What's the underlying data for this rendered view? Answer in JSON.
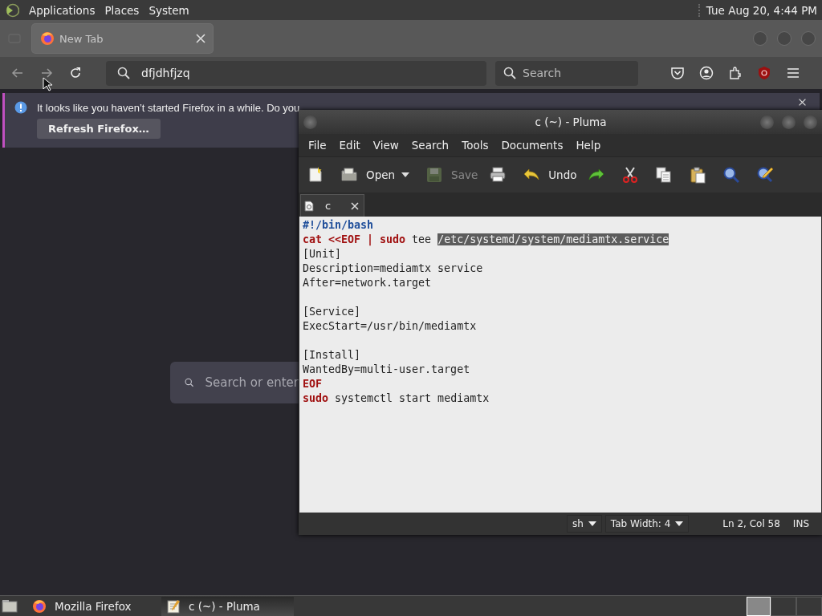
{
  "top_panel": {
    "menus": [
      "Applications",
      "Places",
      "System"
    ],
    "clock": "Tue Aug 20,  4:44 PM"
  },
  "firefox": {
    "tabs": [
      {
        "label": "New Tab",
        "selected": true
      }
    ],
    "url_value": "dfjdhfjzq",
    "search_placeholder": "Search",
    "notification": {
      "message": "It looks like you haven’t started Firefox in a while. Do you",
      "button": "Refresh Firefox…"
    },
    "newtab_search_placeholder": "Search or enter"
  },
  "pluma": {
    "title": "c (~) - Pluma",
    "menus": [
      "File",
      "Edit",
      "View",
      "Search",
      "Tools",
      "Documents",
      "Help"
    ],
    "toolbar": [
      {
        "kind": "new",
        "disabled": false
      },
      {
        "kind": "open",
        "label": "Open",
        "disabled": false
      },
      {
        "kind": "save",
        "label": "Save",
        "disabled": true
      },
      {
        "kind": "print",
        "disabled": false
      },
      {
        "kind": "undo",
        "label": "Undo",
        "disabled": false
      },
      {
        "kind": "redo",
        "disabled": false
      },
      {
        "kind": "cut",
        "disabled": false
      },
      {
        "kind": "copy",
        "disabled": false
      },
      {
        "kind": "paste",
        "disabled": false
      },
      {
        "kind": "find",
        "disabled": false
      },
      {
        "kind": "replace",
        "disabled": false
      }
    ],
    "document_tab": "c",
    "lines": [
      {
        "kind": "code",
        "segments": [
          {
            "kind": "shebang",
            "text": "#!/bin/bash",
            "selected": false
          }
        ]
      },
      {
        "kind": "code",
        "segments": [
          {
            "kind": "keyword",
            "text": "cat <<EOF | sudo",
            "selected": false
          },
          {
            "kind": "text",
            "text": " tee ",
            "selected": false
          },
          {
            "kind": "text",
            "text": "/etc/systemd/system/mediamtx.service",
            "selected": true
          }
        ]
      },
      {
        "kind": "code",
        "segments": [
          {
            "kind": "text",
            "text": "[Unit]",
            "selected": false
          }
        ]
      },
      {
        "kind": "code",
        "segments": [
          {
            "kind": "text",
            "text": "Description=mediamtx service",
            "selected": false
          }
        ]
      },
      {
        "kind": "code",
        "segments": [
          {
            "kind": "text",
            "text": "After=network.target",
            "selected": false
          }
        ]
      },
      {
        "kind": "blank"
      },
      {
        "kind": "code",
        "segments": [
          {
            "kind": "text",
            "text": "[Service]",
            "selected": false
          }
        ]
      },
      {
        "kind": "code",
        "segments": [
          {
            "kind": "text",
            "text": "ExecStart=/usr/bin/mediamtx",
            "selected": false
          }
        ]
      },
      {
        "kind": "blank"
      },
      {
        "kind": "code",
        "segments": [
          {
            "kind": "text",
            "text": "[Install]",
            "selected": false
          }
        ]
      },
      {
        "kind": "code",
        "segments": [
          {
            "kind": "text",
            "text": "WantedBy=multi-user.target",
            "selected": false
          }
        ]
      },
      {
        "kind": "code",
        "segments": [
          {
            "kind": "keyword",
            "text": "EOF",
            "selected": false
          }
        ]
      },
      {
        "kind": "code",
        "segments": [
          {
            "kind": "keyword",
            "text": "sudo",
            "selected": false
          },
          {
            "kind": "text",
            "text": " systemctl start mediamtx",
            "selected": false
          }
        ]
      }
    ],
    "status": {
      "language": "sh",
      "tab_width": "Tab Width:  4",
      "position": "Ln 2, Col 58",
      "mode": "INS"
    }
  },
  "taskbar": [
    {
      "kind": "firefox",
      "label": "Mozilla Firefox",
      "selected": false
    },
    {
      "kind": "pluma",
      "label": "c (~) - Pluma",
      "selected": true
    }
  ]
}
